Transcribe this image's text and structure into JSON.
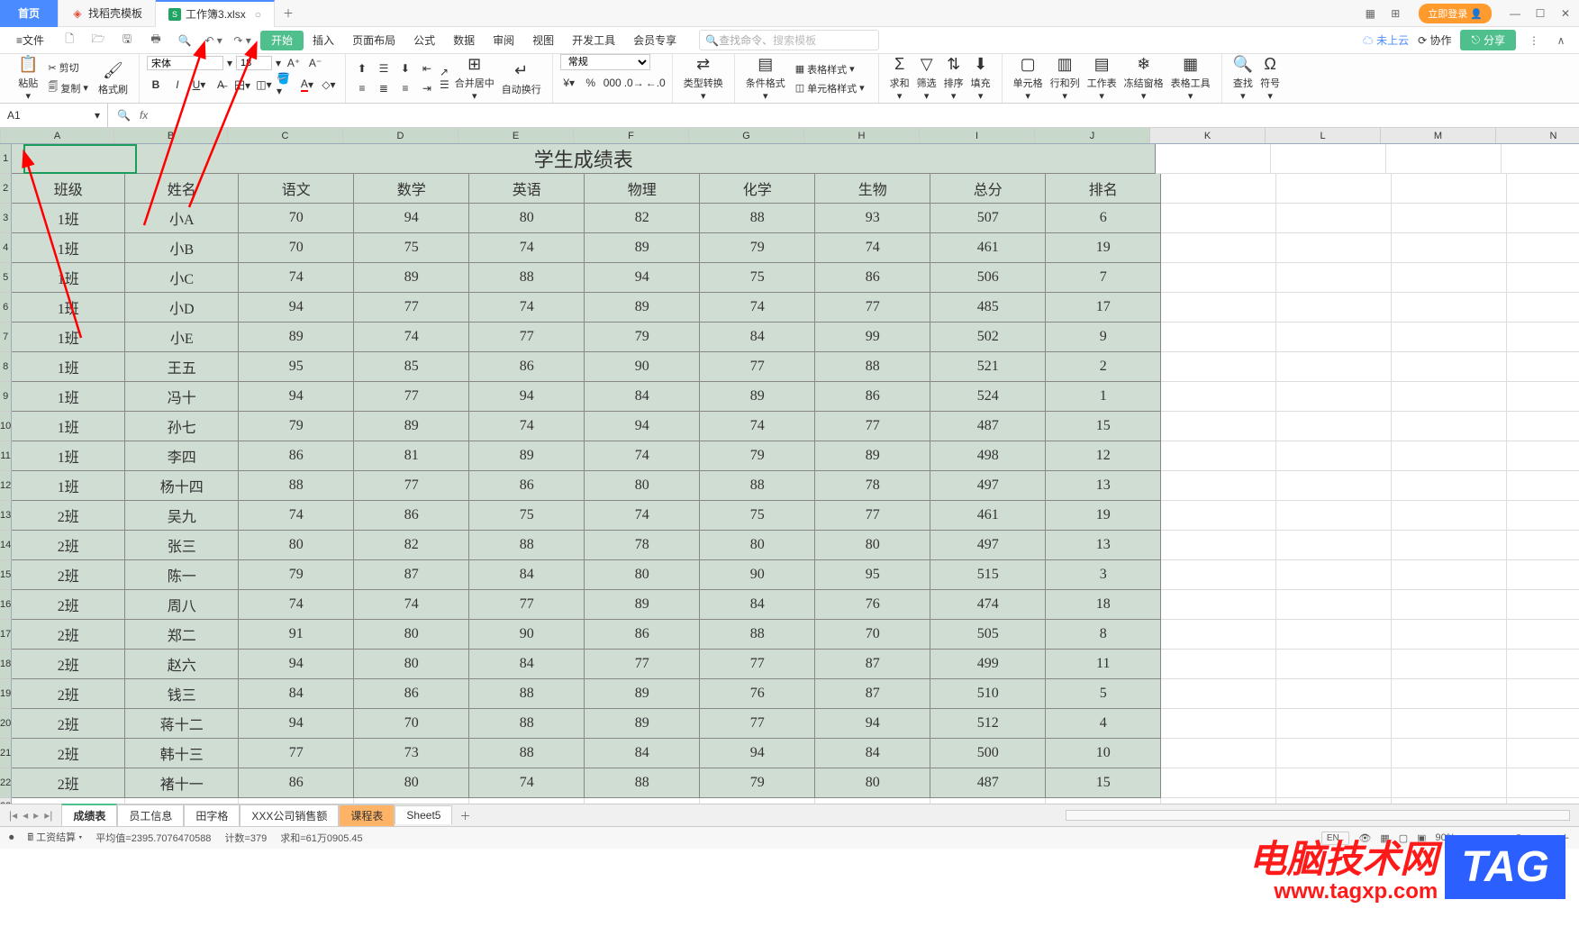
{
  "titlebar": {
    "home": "首页",
    "tab_template": "找稻壳模板",
    "tab_workbook": "工作簿3.xlsx",
    "login": "立即登录"
  },
  "menubar": {
    "file": "文件",
    "items": [
      "开始",
      "插入",
      "页面布局",
      "公式",
      "数据",
      "审阅",
      "视图",
      "开发工具",
      "会员专享"
    ],
    "search_prefix": "查找命令、",
    "search_placeholder": "搜索模板",
    "cloud": "未上云",
    "coop": "协作",
    "share": "分享"
  },
  "ribbon": {
    "paste": "粘贴",
    "cut": "剪切",
    "copy": "复制",
    "format_painter": "格式刷",
    "font_name": "宋体",
    "font_size": "18",
    "merge": "合并居中",
    "wrap": "自动换行",
    "number_format": "常规",
    "type_convert": "类型转换",
    "cond_format": "条件格式",
    "table_style": "表格样式",
    "cell_style": "单元格样式",
    "sum": "求和",
    "filter": "筛选",
    "sort": "排序",
    "fill": "填充",
    "cell": "单元格",
    "rowcol": "行和列",
    "sheet": "工作表",
    "freeze": "冻结窗格",
    "table_tool": "表格工具",
    "find": "查找",
    "symbol": "符号"
  },
  "formula_bar": {
    "name_box": "A1"
  },
  "sheet": {
    "title": "学生成绩表",
    "headers": [
      "班级",
      "姓名",
      "语文",
      "数学",
      "英语",
      "物理",
      "化学",
      "生物",
      "总分",
      "排名"
    ],
    "rows": [
      [
        "1班",
        "小A",
        "70",
        "94",
        "80",
        "82",
        "88",
        "93",
        "507",
        "6"
      ],
      [
        "1班",
        "小B",
        "70",
        "75",
        "74",
        "89",
        "79",
        "74",
        "461",
        "19"
      ],
      [
        "1班",
        "小C",
        "74",
        "89",
        "88",
        "94",
        "75",
        "86",
        "506",
        "7"
      ],
      [
        "1班",
        "小D",
        "94",
        "77",
        "74",
        "89",
        "74",
        "77",
        "485",
        "17"
      ],
      [
        "1班",
        "小E",
        "89",
        "74",
        "77",
        "79",
        "84",
        "99",
        "502",
        "9"
      ],
      [
        "1班",
        "王五",
        "95",
        "85",
        "86",
        "90",
        "77",
        "88",
        "521",
        "2"
      ],
      [
        "1班",
        "冯十",
        "94",
        "77",
        "94",
        "84",
        "89",
        "86",
        "524",
        "1"
      ],
      [
        "1班",
        "孙七",
        "79",
        "89",
        "74",
        "94",
        "74",
        "77",
        "487",
        "15"
      ],
      [
        "1班",
        "李四",
        "86",
        "81",
        "89",
        "74",
        "79",
        "89",
        "498",
        "12"
      ],
      [
        "1班",
        "杨十四",
        "88",
        "77",
        "86",
        "80",
        "88",
        "78",
        "497",
        "13"
      ],
      [
        "2班",
        "吴九",
        "74",
        "86",
        "75",
        "74",
        "75",
        "77",
        "461",
        "19"
      ],
      [
        "2班",
        "张三",
        "80",
        "82",
        "88",
        "78",
        "80",
        "80",
        "497",
        "13"
      ],
      [
        "2班",
        "陈一",
        "79",
        "87",
        "84",
        "80",
        "90",
        "95",
        "515",
        "3"
      ],
      [
        "2班",
        "周八",
        "74",
        "74",
        "77",
        "89",
        "84",
        "76",
        "474",
        "18"
      ],
      [
        "2班",
        "郑二",
        "91",
        "80",
        "90",
        "86",
        "88",
        "70",
        "505",
        "8"
      ],
      [
        "2班",
        "赵六",
        "94",
        "80",
        "84",
        "77",
        "77",
        "87",
        "499",
        "11"
      ],
      [
        "2班",
        "钱三",
        "84",
        "86",
        "88",
        "89",
        "76",
        "87",
        "510",
        "5"
      ],
      [
        "2班",
        "蒋十二",
        "94",
        "70",
        "88",
        "89",
        "77",
        "94",
        "512",
        "4"
      ],
      [
        "2班",
        "韩十三",
        "77",
        "73",
        "88",
        "84",
        "94",
        "84",
        "500",
        "10"
      ],
      [
        "2班",
        "褚十一",
        "86",
        "80",
        "74",
        "88",
        "79",
        "80",
        "487",
        "15"
      ]
    ],
    "col_letters": [
      "A",
      "B",
      "C",
      "D",
      "E",
      "F",
      "G",
      "H",
      "I",
      "J",
      "K",
      "L",
      "M",
      "N"
    ]
  },
  "sheet_tabs": [
    "成绩表",
    "员工信息",
    "田字格",
    "XXX公司销售额",
    "课程表",
    "Sheet5"
  ],
  "status": {
    "calc": "工资结算",
    "avg": "平均值=2395.7076470588",
    "count": "计数=379",
    "sum": "求和=61万0905.45",
    "lang": "EN",
    "zoom": "90%"
  },
  "watermark": {
    "text": "电脑技术网",
    "url": "www.tagxp.com",
    "tag": "TAG"
  },
  "chart_data": {
    "type": "table",
    "title": "学生成绩表",
    "columns": [
      "班级",
      "姓名",
      "语文",
      "数学",
      "英语",
      "物理",
      "化学",
      "生物",
      "总分",
      "排名"
    ],
    "rows": [
      [
        "1班",
        "小A",
        70,
        94,
        80,
        82,
        88,
        93,
        507,
        6
      ],
      [
        "1班",
        "小B",
        70,
        75,
        74,
        89,
        79,
        74,
        461,
        19
      ],
      [
        "1班",
        "小C",
        74,
        89,
        88,
        94,
        75,
        86,
        506,
        7
      ],
      [
        "1班",
        "小D",
        94,
        77,
        74,
        89,
        74,
        77,
        485,
        17
      ],
      [
        "1班",
        "小E",
        89,
        74,
        77,
        79,
        84,
        99,
        502,
        9
      ],
      [
        "1班",
        "王五",
        95,
        85,
        86,
        90,
        77,
        88,
        521,
        2
      ],
      [
        "1班",
        "冯十",
        94,
        77,
        94,
        84,
        89,
        86,
        524,
        1
      ],
      [
        "1班",
        "孙七",
        79,
        89,
        74,
        94,
        74,
        77,
        487,
        15
      ],
      [
        "1班",
        "李四",
        86,
        81,
        89,
        74,
        79,
        89,
        498,
        12
      ],
      [
        "1班",
        "杨十四",
        88,
        77,
        86,
        80,
        88,
        78,
        497,
        13
      ],
      [
        "2班",
        "吴九",
        74,
        86,
        75,
        74,
        75,
        77,
        461,
        19
      ],
      [
        "2班",
        "张三",
        80,
        82,
        88,
        78,
        80,
        80,
        497,
        13
      ],
      [
        "2班",
        "陈一",
        79,
        87,
        84,
        80,
        90,
        95,
        515,
        3
      ],
      [
        "2班",
        "周八",
        74,
        74,
        77,
        89,
        84,
        76,
        474,
        18
      ],
      [
        "2班",
        "郑二",
        91,
        80,
        90,
        86,
        88,
        70,
        505,
        8
      ],
      [
        "2班",
        "赵六",
        94,
        80,
        84,
        77,
        77,
        87,
        499,
        11
      ],
      [
        "2班",
        "钱三",
        84,
        86,
        88,
        89,
        76,
        87,
        510,
        5
      ],
      [
        "2班",
        "蒋十二",
        94,
        70,
        88,
        89,
        77,
        94,
        512,
        4
      ],
      [
        "2班",
        "韩十三",
        77,
        73,
        88,
        84,
        94,
        84,
        500,
        10
      ],
      [
        "2班",
        "褚十一",
        86,
        80,
        74,
        88,
        79,
        80,
        487,
        15
      ]
    ]
  }
}
